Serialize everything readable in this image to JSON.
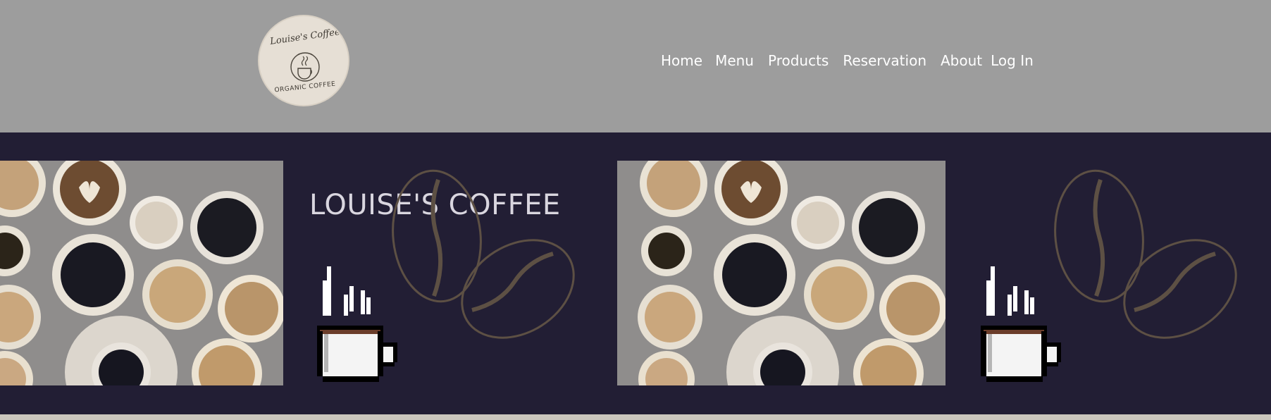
{
  "logo": {
    "script_text": "Louise's Coffee",
    "subtitle": "ORGANIC COFFEE"
  },
  "nav": {
    "items": [
      {
        "label": "Home"
      },
      {
        "label": "Menu"
      },
      {
        "label": "Products"
      },
      {
        "label": "Reservation"
      },
      {
        "label": "About"
      },
      {
        "label": "Log In"
      }
    ]
  },
  "hero": {
    "title": "LOUISE'S COFFEE"
  },
  "colors": {
    "header_bg": "#9d9d9d",
    "hero_bg": "#221e34",
    "logo_bg": "#e6dfd5",
    "nav_text": "#ffffff"
  }
}
